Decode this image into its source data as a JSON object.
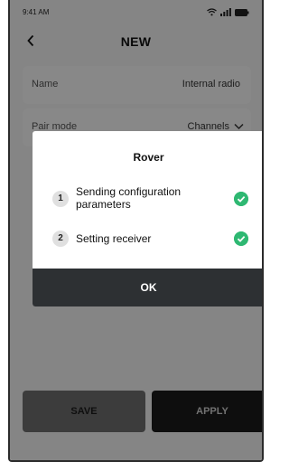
{
  "status": {
    "time": "9:41 AM"
  },
  "header": {
    "back_icon": "chevron-left-icon",
    "title": "NEW"
  },
  "form": {
    "rows": [
      {
        "label": "Name",
        "value": "Internal radio"
      },
      {
        "label": "Pair mode",
        "value": "Channels"
      }
    ]
  },
  "dialog": {
    "title": "Rover",
    "steps": [
      {
        "number": "1",
        "text": "Sending configuration parameters",
        "status_icon": "check-circle-icon"
      },
      {
        "number": "2",
        "text": "Setting receiver",
        "status_icon": "check-circle-icon"
      }
    ],
    "ok_label": "OK"
  },
  "footer": {
    "save_label": "SAVE",
    "apply_label": "APPLY"
  },
  "colors": {
    "success": "#2eb872",
    "dark": "#2d3033"
  }
}
